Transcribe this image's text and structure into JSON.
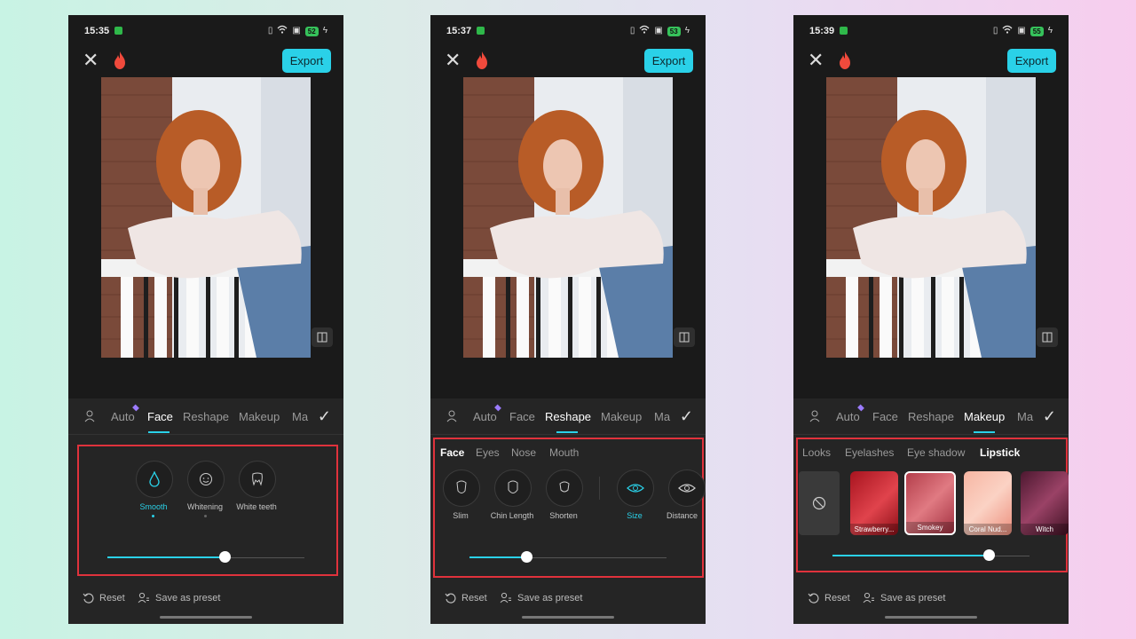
{
  "colors": {
    "accent": "#2ad1e8",
    "highlight_box": "#e0323c",
    "battery": "#36c25b"
  },
  "phones": [
    {
      "time": "15:35",
      "battery": "52",
      "export_label": "Export",
      "tabs": [
        "Auto",
        "Face",
        "Reshape",
        "Makeup",
        "Ma"
      ],
      "active_tab": "Face",
      "options": [
        {
          "label": "Smooth",
          "icon": "drop-icon",
          "active": true
        },
        {
          "label": "Whitening",
          "icon": "face-icon",
          "active": false
        },
        {
          "label": "White teeth",
          "icon": "teeth-icon",
          "active": false
        }
      ],
      "slider_value": 0.6,
      "reset_label": "Reset",
      "preset_label": "Save as preset"
    },
    {
      "time": "15:37",
      "battery": "53",
      "export_label": "Export",
      "tabs": [
        "Auto",
        "Face",
        "Reshape",
        "Makeup",
        "Ma"
      ],
      "active_tab": "Reshape",
      "subtabs": [
        "Face",
        "Eyes",
        "Nose",
        "Mouth"
      ],
      "active_subtab": "Face",
      "options": [
        {
          "label": "Slim",
          "icon": "face-slim-icon"
        },
        {
          "label": "Chin Length",
          "icon": "chin-icon"
        },
        {
          "label": "Shorten",
          "icon": "face-shorten-icon"
        },
        {
          "label": "Size",
          "icon": "eye-size-icon",
          "active": true
        },
        {
          "label": "Distance",
          "icon": "eye-distance-icon"
        }
      ],
      "slider_value": 0.3,
      "reset_label": "Reset",
      "preset_label": "Save as preset"
    },
    {
      "time": "15:39",
      "battery": "55",
      "export_label": "Export",
      "tabs": [
        "Auto",
        "Face",
        "Reshape",
        "Makeup",
        "Ma"
      ],
      "active_tab": "Makeup",
      "subtabs": [
        "Looks",
        "Eyelashes",
        "Eye shadow",
        "Lipstick"
      ],
      "active_subtab": "Lipstick",
      "swatches": [
        {
          "label": "Strawberry...",
          "color": "#c42a33"
        },
        {
          "label": "Smokey",
          "color": "#c9545f",
          "selected": true
        },
        {
          "label": "Coral Nud...",
          "color": "#f2a08f"
        },
        {
          "label": "Witch",
          "color": "#6b2540"
        }
      ],
      "slider_value": 0.8,
      "reset_label": "Reset",
      "preset_label": "Save as preset"
    }
  ]
}
